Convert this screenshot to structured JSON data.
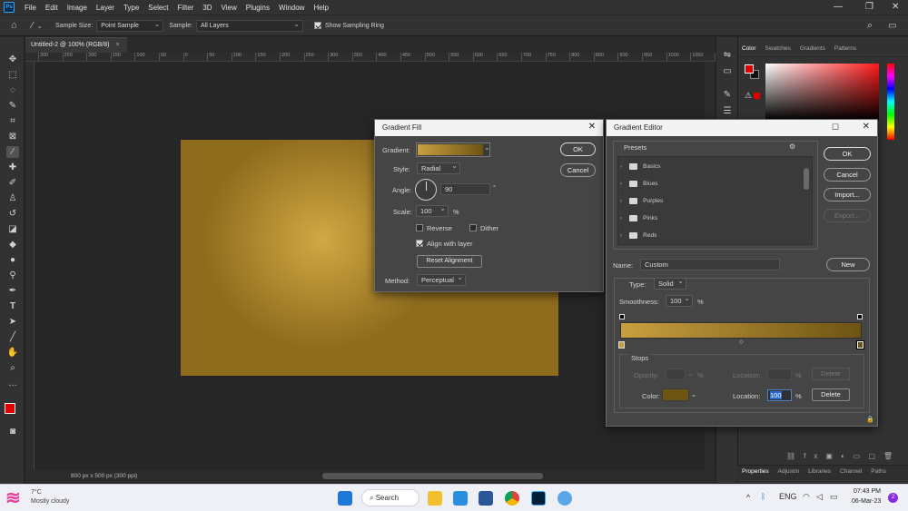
{
  "app": {
    "logo": "Ps",
    "title": "Adobe Photoshop"
  },
  "menubar": {
    "items": [
      "File",
      "Edit",
      "Image",
      "Layer",
      "Type",
      "Select",
      "Filter",
      "3D",
      "View",
      "Plugins",
      "Window",
      "Help"
    ],
    "minimize": "—",
    "restore": "❐",
    "close": "✕"
  },
  "options": {
    "sample_size_label": "Sample Size:",
    "sample_size_value": "Point Sample",
    "sample_label": "Sample:",
    "sample_value": "All Layers",
    "show_ring_label": "Show Sampling Ring"
  },
  "document": {
    "tab_title": "Untitled-2 @ 100% (RGB/8)",
    "tab_close": "×",
    "status": "800 px x 500 px (300 ppi)",
    "ruler_ticks": [
      "300",
      "250",
      "200",
      "150",
      "100",
      "50",
      "0",
      "50",
      "100",
      "150",
      "200",
      "250",
      "300",
      "350",
      "400",
      "450",
      "500",
      "550",
      "600",
      "650",
      "700",
      "750",
      "800",
      "850",
      "900",
      "950",
      "1000",
      "1050",
      "1100"
    ]
  },
  "right_panel": {
    "tabs": [
      "Color",
      "Swatches",
      "Gradients",
      "Patterns"
    ],
    "bottom_tabs": [
      "Properties",
      "Adjustm",
      "Libraries",
      "Channel",
      "Paths"
    ],
    "fg_color": "#e00000",
    "bg_color": "#111111"
  },
  "gradient_fill": {
    "title": "Gradient Fill",
    "close": "✕",
    "gradient_label": "Gradient:",
    "style_label": "Style:",
    "style_value": "Radial",
    "angle_label": "Angle:",
    "angle_value": "90",
    "angle_unit": "°",
    "scale_label": "Scale:",
    "scale_value": "100",
    "scale_unit": "%",
    "reverse_label": "Reverse",
    "dither_label": "Dither",
    "align_label": "Align with layer",
    "reset_button": "Reset Alignment",
    "method_label": "Method:",
    "method_value": "Perceptual",
    "ok": "OK",
    "cancel": "Cancel"
  },
  "gradient_editor": {
    "title": "Gradient Editor",
    "maximize": "☐",
    "close": "✕",
    "presets_label": "Presets",
    "presets": [
      "Basics",
      "Blues",
      "Purples",
      "Pinks",
      "Reds"
    ],
    "name_label": "Name:",
    "name_value": "Custom",
    "new_button": "New",
    "type_label": "Type:",
    "type_value": "Solid",
    "smoothness_label": "Smoothness:",
    "smoothness_value": "100",
    "smoothness_unit": "%",
    "stops_label": "Stops",
    "opacity_label": "Opacity:",
    "opacity_unit": "%",
    "location_label_top": "Location:",
    "location_unit_top": "%",
    "delete_top": "Delete",
    "color_label": "Color:",
    "location_label": "Location:",
    "location_value": "100",
    "location_unit": "%",
    "delete_button": "Delete",
    "ok": "OK",
    "cancel": "Cancel",
    "import": "Import...",
    "export": "Export...",
    "gradient_start": "#c9a040",
    "gradient_end": "#6e5413",
    "stop_color": "#6e5413"
  },
  "taskbar": {
    "weather_temp": "7°C",
    "weather_text": "Mostly cloudy",
    "search": "Search",
    "time": "07:43 PM",
    "date": "06-Mar-23",
    "notif_count": "2",
    "lang": "ENG"
  }
}
